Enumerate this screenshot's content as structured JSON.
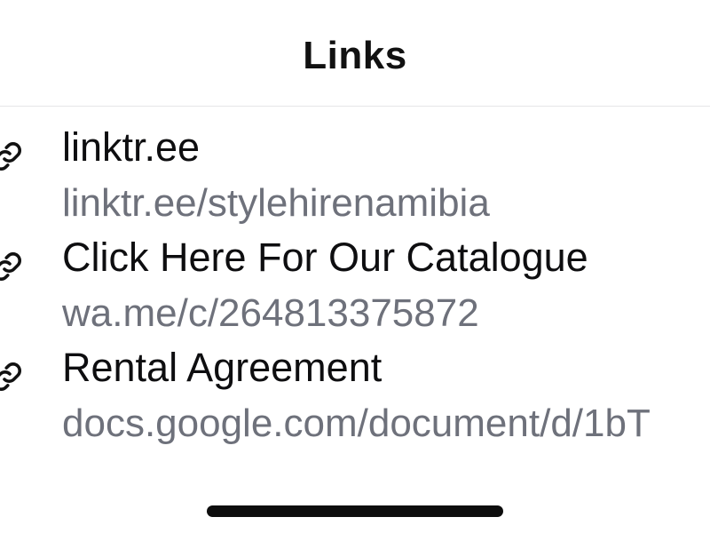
{
  "header": {
    "title": "Links"
  },
  "links": [
    {
      "title": "linktr.ee",
      "url": "linktr.ee/stylehirenamibia",
      "icon": "link-icon"
    },
    {
      "title": "Click Here For Our Catalogue",
      "url": "wa.me/c/264813375872",
      "icon": "link-icon"
    },
    {
      "title": "Rental Agreement",
      "url": "docs.google.com/document/d/1bT",
      "icon": "link-icon"
    }
  ],
  "colors": {
    "title_text": "#111111",
    "link_title": "#0e0e10",
    "link_url": "#6e717b",
    "divider": "#e6e6e8",
    "home_indicator": "#0d0d0d"
  }
}
